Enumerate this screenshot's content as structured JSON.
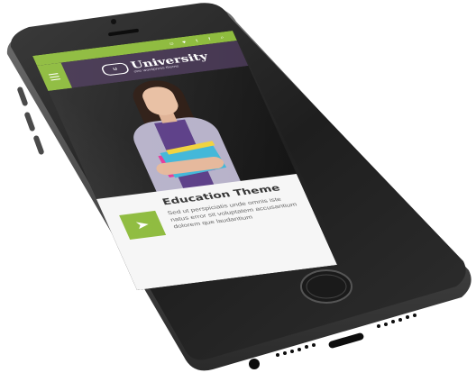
{
  "topbar": {
    "accent": "#8cba3a",
    "icons": [
      "user-icon",
      "heart-icon",
      "twitter-icon",
      "facebook-icon",
      "search-icon"
    ],
    "glyphs": [
      "☺",
      "♥",
      "t",
      "f",
      "⌕"
    ]
  },
  "header": {
    "background": "#43344f",
    "logo_mark": "U",
    "brand": "University",
    "tagline": "one wordpress theme"
  },
  "feature": {
    "title": "Education Theme",
    "description": "Sed ut perspiciatis unde omnis iste natus error sit voluptatem accusantium dolorem que laudantium",
    "icon": "paper-plane-icon",
    "icon_glyph": "➤"
  }
}
